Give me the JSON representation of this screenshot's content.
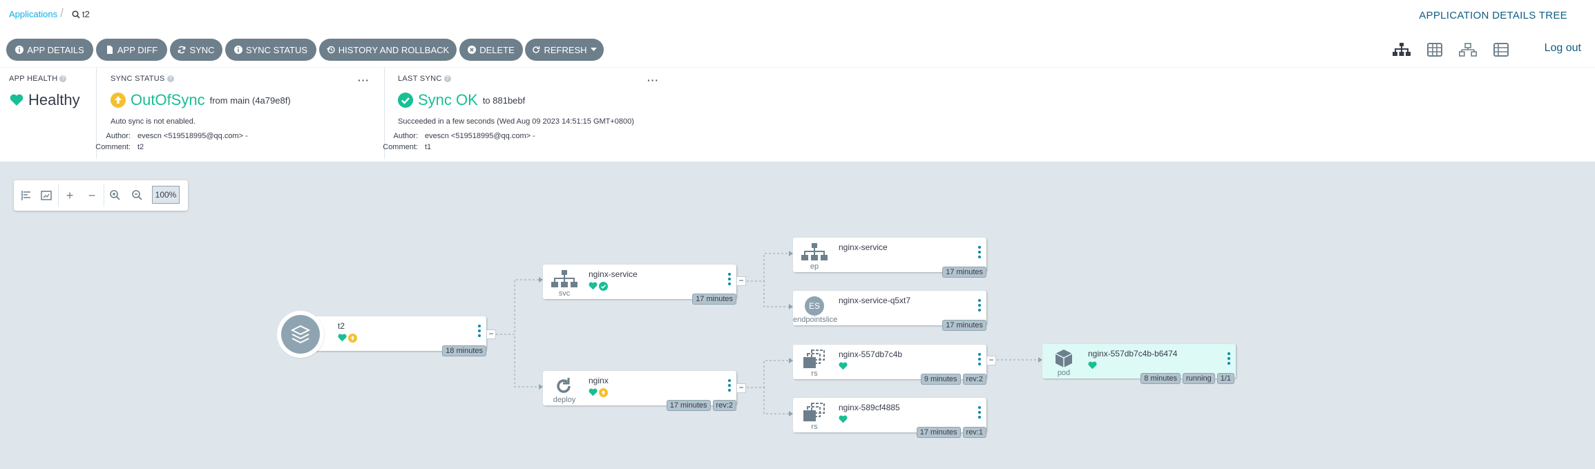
{
  "breadcrumb": {
    "applications": "Applications",
    "current": "t2"
  },
  "page_title": "APPLICATION DETAILS TREE",
  "toolbar": {
    "buttons": [
      "APP DETAILS",
      "APP DIFF",
      "SYNC",
      "SYNC STATUS",
      "HISTORY AND ROLLBACK",
      "DELETE",
      "REFRESH"
    ],
    "logout": "Log out"
  },
  "status_panel": {
    "app_health": {
      "title": "APP HEALTH",
      "value": "Healthy"
    },
    "sync_status": {
      "title": "SYNC STATUS",
      "value": "OutOfSync",
      "detail": "from main (4a79e8f)",
      "note": "Auto sync is not enabled.",
      "author_label": "Author:",
      "author": "evescn <519518995@qq.com> -",
      "comment_label": "Comment:",
      "comment": "t2"
    },
    "last_sync": {
      "title": "LAST SYNC",
      "value": "Sync OK",
      "detail": "to 881bebf",
      "note": "Succeeded in a few seconds (Wed Aug 09 2023 14:51:15 GMT+0800)",
      "author_label": "Author:",
      "author": "evescn <519518995@qq.com> -",
      "comment_label": "Comment:",
      "comment": "t1"
    }
  },
  "zoom": {
    "level": "100%"
  },
  "nodes": {
    "root": {
      "name": "t2",
      "age": "18 minutes"
    },
    "svc": {
      "name": "nginx-service",
      "kind": "svc",
      "age": "17 minutes"
    },
    "deploy": {
      "name": "nginx",
      "kind": "deploy",
      "age": "17 minutes",
      "rev": "rev:2"
    },
    "ep": {
      "name": "nginx-service",
      "kind": "ep",
      "age": "17 minutes"
    },
    "es": {
      "name": "nginx-service-q5xt7",
      "kind": "endpointslice",
      "icon_text": "ES",
      "age": "17 minutes"
    },
    "rs1": {
      "name": "nginx-557db7c4b",
      "kind": "rs",
      "age": "9 minutes",
      "rev": "rev:2"
    },
    "rs2": {
      "name": "nginx-589cf4885",
      "kind": "rs",
      "age": "17 minutes",
      "rev": "rev:1"
    },
    "pod": {
      "name": "nginx-557db7c4b-b6474",
      "kind": "pod",
      "age": "8 minutes",
      "state": "running",
      "ready": "1/1"
    }
  },
  "colors": {
    "healthy": "#18be94",
    "out_of_sync": "#f4c030",
    "accent": "#0dadea",
    "button": "#6d7f8b"
  }
}
